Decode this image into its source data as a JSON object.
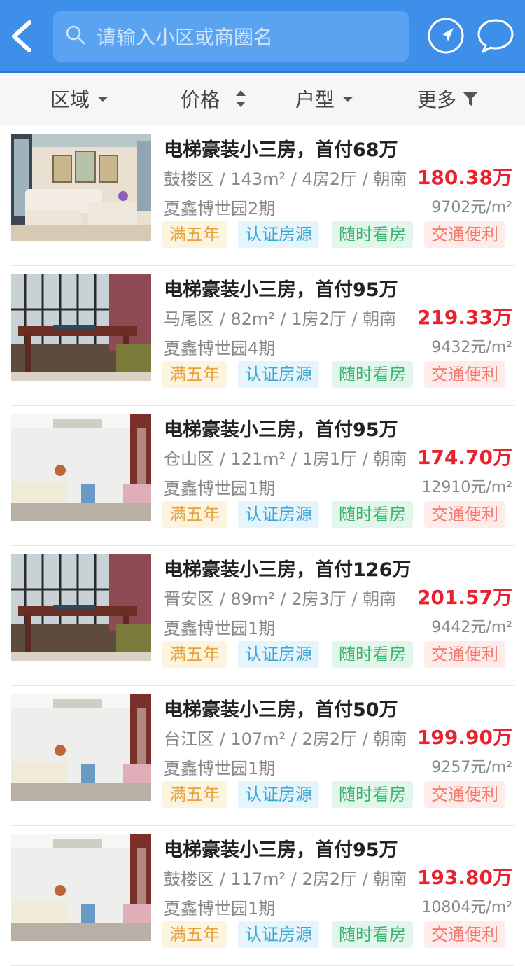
{
  "colors": {
    "header_bg": "#3d8fe9",
    "price_red": "#e8222e"
  },
  "header": {
    "back_icon": "chevron-left-icon",
    "search_placeholder": "请输入小区或商圈名",
    "search_icon": "search-icon",
    "location_icon": "navigation-arrow-icon",
    "message_icon": "chat-bubble-icon"
  },
  "filters": [
    {
      "label": "区域",
      "icon": "caret-down-icon"
    },
    {
      "label": "价格",
      "icon": "sort-updown-icon"
    },
    {
      "label": "户型",
      "icon": "caret-down-icon"
    },
    {
      "label": "更多",
      "icon": "funnel-icon"
    }
  ],
  "listings": [
    {
      "title": "电梯豪装小三房，首付68万",
      "district": "鼓楼区",
      "area": "143m²",
      "layout": "4房2厅",
      "orientation": "朝南",
      "price": "180.38万",
      "community": "夏鑫博世园2期",
      "unit_price": "9702元/m²",
      "tags": [
        "满五年",
        "认证房源",
        "随时看房",
        "交通便利"
      ],
      "image": "living-room-photo"
    },
    {
      "title": "电梯豪装小三房，首付95万",
      "district": "马尾区",
      "area": "82m²",
      "layout": "1房2厅",
      "orientation": "朝南",
      "price": "219.33万",
      "community": "夏鑫博世园4期",
      "unit_price": "9432元/m²",
      "tags": [
        "满五年",
        "认证房源",
        "随时看房",
        "交通便利"
      ],
      "image": "tea-room-photo"
    },
    {
      "title": "电梯豪装小三房，首付95万",
      "district": "仓山区",
      "area": "121m²",
      "layout": "1房1厅",
      "orientation": "朝南",
      "price": "174.70万",
      "community": "夏鑫博世园1期",
      "unit_price": "12910元/m²",
      "tags": [
        "满五年",
        "认证房源",
        "随时看房",
        "交通便利"
      ],
      "image": "white-living-room-photo"
    },
    {
      "title": "电梯豪装小三房，首付126万",
      "district": "晋安区",
      "area": "89m²",
      "layout": "2房3厅",
      "orientation": "朝南",
      "price": "201.57万",
      "community": "夏鑫博世园1期",
      "unit_price": "9442元/m²",
      "tags": [
        "满五年",
        "认证房源",
        "随时看房",
        "交通便利"
      ],
      "image": "tea-room-photo"
    },
    {
      "title": "电梯豪装小三房，首付50万",
      "district": "台江区",
      "area": "107m²",
      "layout": "2房2厅",
      "orientation": "朝南",
      "price": "199.90万",
      "community": "夏鑫博世园1期",
      "unit_price": "9257元/m²",
      "tags": [
        "满五年",
        "认证房源",
        "随时看房",
        "交通便利"
      ],
      "image": "white-living-room-photo"
    },
    {
      "title": "电梯豪装小三房，首付95万",
      "district": "鼓楼区",
      "area": "117m²",
      "layout": "2房2厅",
      "orientation": "朝南",
      "price": "193.80万",
      "community": "夏鑫博世园1期",
      "unit_price": "10804元/m²",
      "tags": [
        "满五年",
        "认证房源",
        "随时看房",
        "交通便利"
      ],
      "image": "white-living-room-photo"
    }
  ]
}
